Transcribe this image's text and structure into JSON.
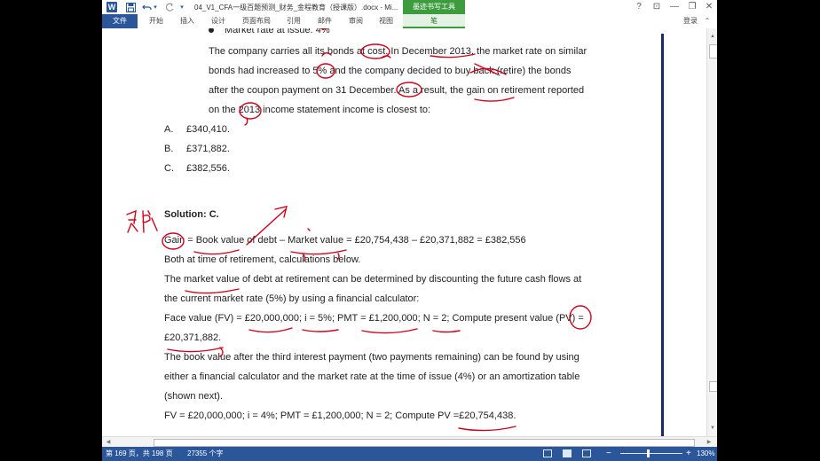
{
  "titlebar": {
    "app_icon": "W",
    "title": "04_V1_CFA一级百题预测_财务_金程教育（授课版）.docx - Mi...",
    "ink_tools_tab": "墨迹书写工具",
    "icons": [
      "word-icon",
      "save-icon",
      "undo-icon",
      "redo-icon",
      "help-icon",
      "restore-ribbon-icon",
      "minimize-icon",
      "maximize-icon",
      "close-icon"
    ],
    "help": "?",
    "ribbon_display": "⊡",
    "minimize": "—",
    "restore": "❐",
    "close": "✕"
  },
  "ribbon": {
    "tabs": [
      "文件",
      "开始",
      "插入",
      "设计",
      "页面布局",
      "引用",
      "邮件",
      "审阅",
      "视图",
      "笔"
    ],
    "login": "登录"
  },
  "document": {
    "partial_line": "Market rate at issue: 4%",
    "para": [
      "The company carries all its bonds at cost. In December 2013, the market rate on similar",
      "bonds had increased to 5% and the company decided to buy back (retire) the bonds",
      "after the coupon payment on 31 December. As a result, the gain on retirement reported",
      "on the 2013 income statement income is closest to:"
    ],
    "options": [
      {
        "letter": "A.",
        "text": "£340,410."
      },
      {
        "letter": "B.",
        "text": "£371,882."
      },
      {
        "letter": "C.",
        "text": "£382,556."
      }
    ],
    "solution_title": "Solution: C.",
    "solution_lines": [
      "Gain = Book value of debt – Market value = £20,754,438 – £20,371,882 = £382,556",
      "Both at time of retirement, calculations below.",
      "The market value of debt at retirement can be determined by discounting the future cash flows at",
      "the current market rate (5%) by using a financial calculator:",
      "Face value (FV) = £20,000,000; i = 5%; PMT = £1,200,000; N = 2; Compute present value (PV) =",
      "£20,371,882.",
      "The book value after the third interest payment (two payments remaining) can be found by using",
      "either a financial calculator and the market rate at the time of issue (4%) or an amortization table",
      "(shown next).",
      "FV = £20,000,000; i = 4%; PMT = £1,200,000; N = 2; Compute PV =£20,754,438."
    ],
    "handwriting": "买卖"
  },
  "statusbar": {
    "page": "第 169 页，共 198 页",
    "words": "27355 个字",
    "zoom": "130%",
    "zoom_level_percent": 130
  },
  "colors": {
    "word_blue": "#2b579a",
    "ink_green": "#3e9c3e",
    "annotation_red": "#d0021b"
  }
}
